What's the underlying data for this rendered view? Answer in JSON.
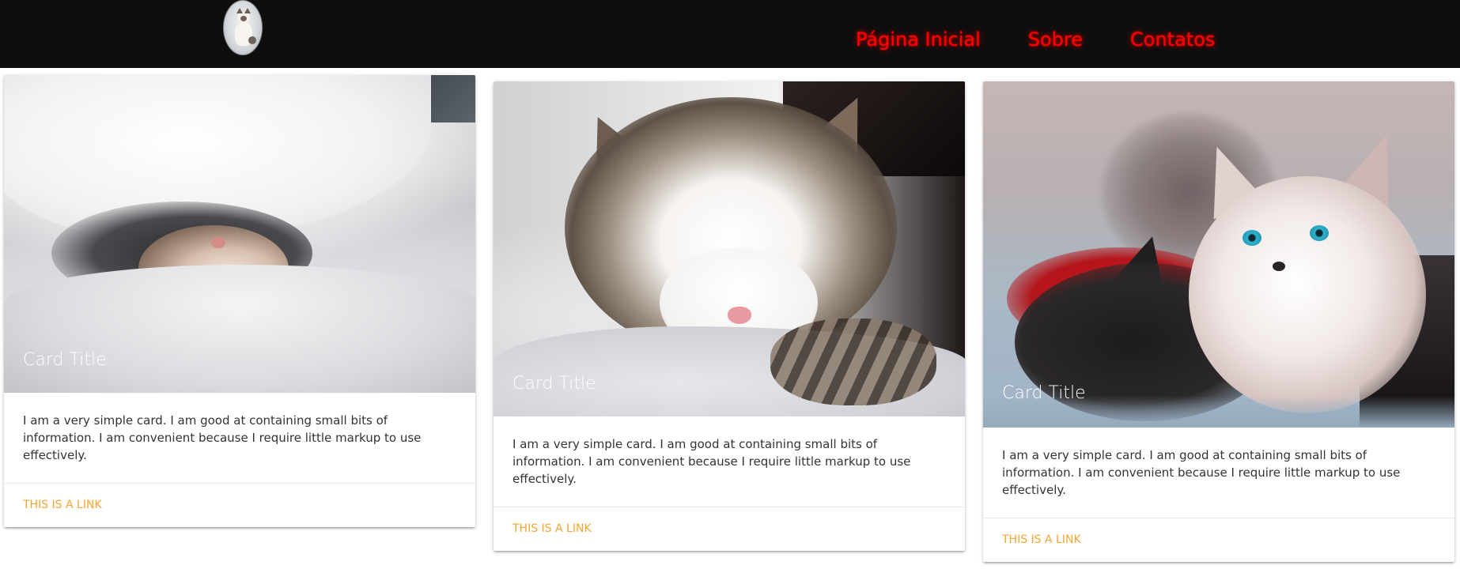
{
  "navbar": {
    "logo_icon": "kitten-logo-icon",
    "links": [
      "Página Inicial",
      "Sobre",
      "Contatos"
    ],
    "link_color": "#ff0000",
    "background": "#0e0e0e"
  },
  "cards": [
    {
      "title": "Card Title",
      "image": "kitten-under-blanket",
      "text": "I am a very simple card. I am good at containing small bits of information. I am convenient because I require little markup to use effectively.",
      "link": "This is a link"
    },
    {
      "title": "Card Title",
      "image": "tabby-kitten-sleeping",
      "text": "I am a very simple card. I am good at containing small bits of information. I am convenient because I require little markup to use effectively.",
      "link": "This is a link"
    },
    {
      "title": "Card Title",
      "image": "two-kittens-on-blanket",
      "text": "I am a very simple card. I am good at containing small bits of information. I am convenient because I require little markup to use effectively.",
      "link": "This is a link"
    }
  ],
  "colors": {
    "link_accent": "#f5a530"
  }
}
